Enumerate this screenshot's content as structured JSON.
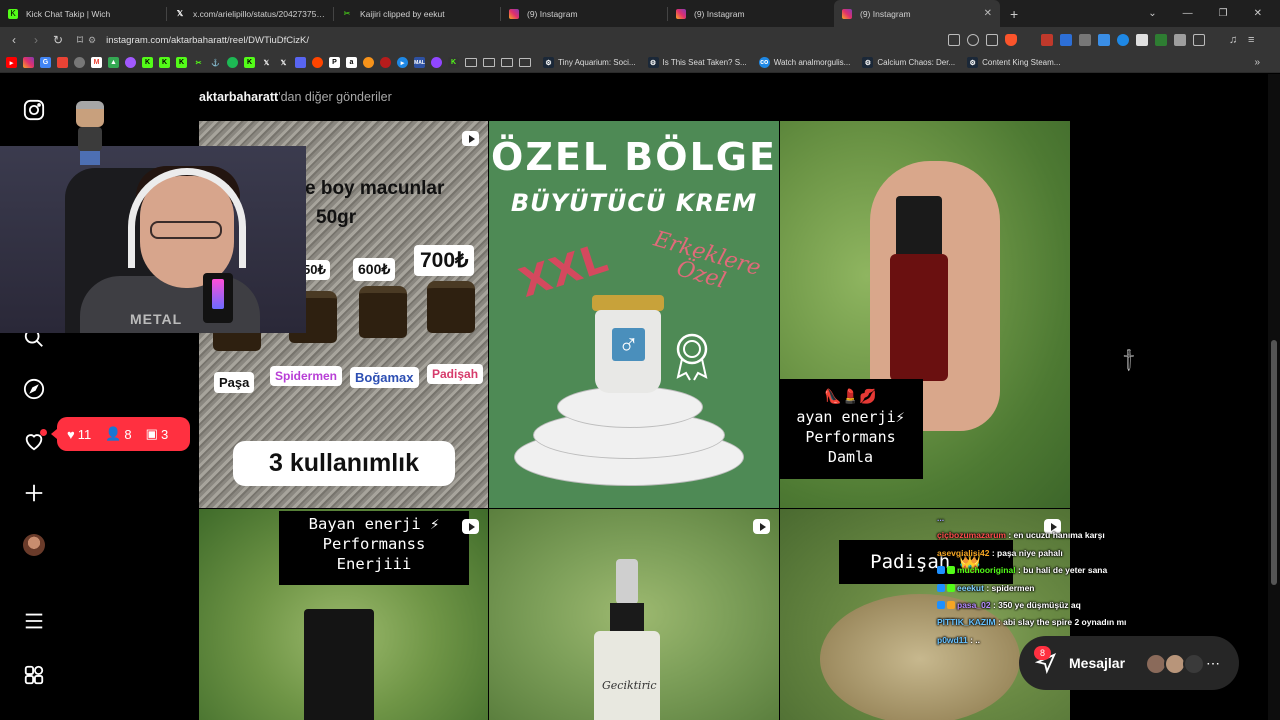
{
  "browser": {
    "tabs": [
      {
        "title": "Kick Chat Takip | Wich",
        "icon": "kick-icon",
        "color": "#53fc18"
      },
      {
        "title": "x.com/arielipillo/status/20427375277",
        "icon": "x-icon",
        "color": "#ffffff"
      },
      {
        "title": "Kaijiri clipped by eekut",
        "icon": "kick-clip-icon",
        "color": "#53fc18"
      },
      {
        "title": "(9) Instagram",
        "icon": "instagram-icon",
        "color": "#e1306c"
      },
      {
        "title": "(9) Instagram",
        "icon": "instagram-icon",
        "color": "#e1306c"
      },
      {
        "title": "(9) Instagram",
        "icon": "instagram-icon",
        "color": "#e1306c",
        "active": true
      }
    ],
    "url": "instagram.com/aktarbaharatt/reel/DWTiuDfCizK/",
    "bookmarks": [
      {
        "label": "Tiny Aquarium: Soci...",
        "icon": "steam-icon"
      },
      {
        "label": "Is This Seat Taken? S...",
        "icon": "steam-icon"
      },
      {
        "label": "Watch analmorgulis...",
        "icon": "globe-icon"
      },
      {
        "label": "Calcium Chaos: Der...",
        "icon": "steam-icon"
      },
      {
        "label": "Content King Steam...",
        "icon": "steam-icon"
      }
    ]
  },
  "instagram": {
    "more_posts_user": "aktarbaharatt",
    "more_posts_suffix": "'dan diğer gönderiler",
    "notifications": {
      "likes": "11",
      "follows": "8",
      "tags": "3"
    },
    "messages_label": "Mesajlar",
    "messages_badge": "8",
    "posts": {
      "p1": {
        "line1": "e boy macunlar",
        "line2": "50gr",
        "prices": [
          "50₺",
          "600₺",
          "700₺"
        ],
        "labels": [
          {
            "text": "Paşa",
            "color": "#111111"
          },
          {
            "text": "Spidermen",
            "color": "#b83fd6"
          },
          {
            "text": "Boğamax",
            "color": "#2d4fb3"
          },
          {
            "text": "Padişah",
            "color": "#d63b6b"
          }
        ],
        "footer": "3 kullanımlık"
      },
      "p2": {
        "title1": "ÖZEL BÖLGE",
        "title2": "BÜYÜTÜCÜ KREM",
        "xxl": "XXL",
        "erk1": "Erkeklere",
        "erk2": "Özel",
        "symbol": "♂"
      },
      "p3": {
        "emoji": "👠💄💋",
        "line1": "ayan enerji⚡",
        "line2": "Performans",
        "line3": "Damla"
      },
      "p4": {
        "line1": "Bayan enerji ⚡",
        "line2": "Performanss",
        "line3": "Enerjiii"
      },
      "p5": {
        "label": "Geciktiric"
      },
      "p6": {
        "title": "Padişah",
        "emoji": "👑"
      }
    }
  },
  "webcam": {
    "shirt_text": "METAL"
  },
  "chat": [
    {
      "user": "...",
      "text": "",
      "color": "#9a9aff"
    },
    {
      "user": "çiçbozumazarum",
      "text": ": en ucuzu hanıma karşı",
      "color": "#ff4d4d"
    },
    {
      "user": "asevgialisi42",
      "text": ": paşa niye pahalı",
      "color": "#f5a623"
    },
    {
      "user": "muchooriginal",
      "text": ": bu hali de yeter sana",
      "color": "#53fc18"
    },
    {
      "user": "eeekut",
      "text": ": spidermen",
      "color": "#7fd0ff"
    },
    {
      "user": "pasa_02",
      "text": ": 350 ye düşmüşüz aq",
      "color": "#b68cff"
    },
    {
      "user": "PITTIK_KAZIM",
      "text": ": abi slay the spire 2 oynadın mı",
      "color": "#66c2ff"
    },
    {
      "user": "p0wd11",
      "text": ": ..",
      "color": "#66c2ff"
    }
  ]
}
